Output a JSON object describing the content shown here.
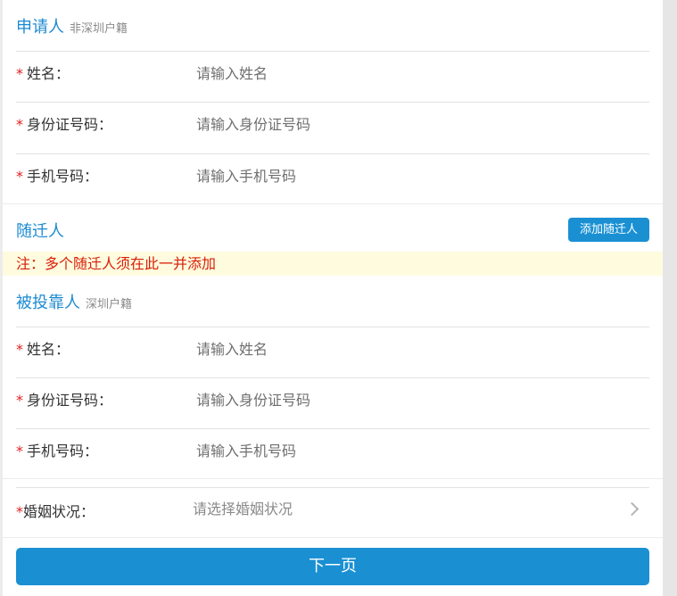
{
  "applicant": {
    "title": "申请人",
    "subtitle": "非深圳户籍",
    "fields": [
      {
        "label": "姓名：",
        "placeholder": "请输入姓名"
      },
      {
        "label": "身份证号码：",
        "placeholder": "请输入身份证号码"
      },
      {
        "label": "手机号码：",
        "placeholder": "请输入手机号码"
      }
    ]
  },
  "companions": {
    "title": "随迁人",
    "add_button": "添加随迁人",
    "notice": "注：多个随迁人须在此一并添加"
  },
  "dependee": {
    "title": "被投靠人",
    "subtitle": "深圳户籍",
    "fields": [
      {
        "label": "姓名：",
        "placeholder": "请输入姓名"
      },
      {
        "label": "身份证号码：",
        "placeholder": "请输入身份证号码"
      },
      {
        "label": "手机号码：",
        "placeholder": "请输入手机号码"
      }
    ]
  },
  "marital": {
    "label": "婚姻状况：",
    "placeholder": "请选择婚姻状况"
  },
  "required_mark": "*",
  "next_button": "下一页",
  "colors": {
    "accent": "#1a90d3",
    "required": "#e02020",
    "notice_bg": "#fffbdf",
    "notice_text": "#d81e06"
  }
}
